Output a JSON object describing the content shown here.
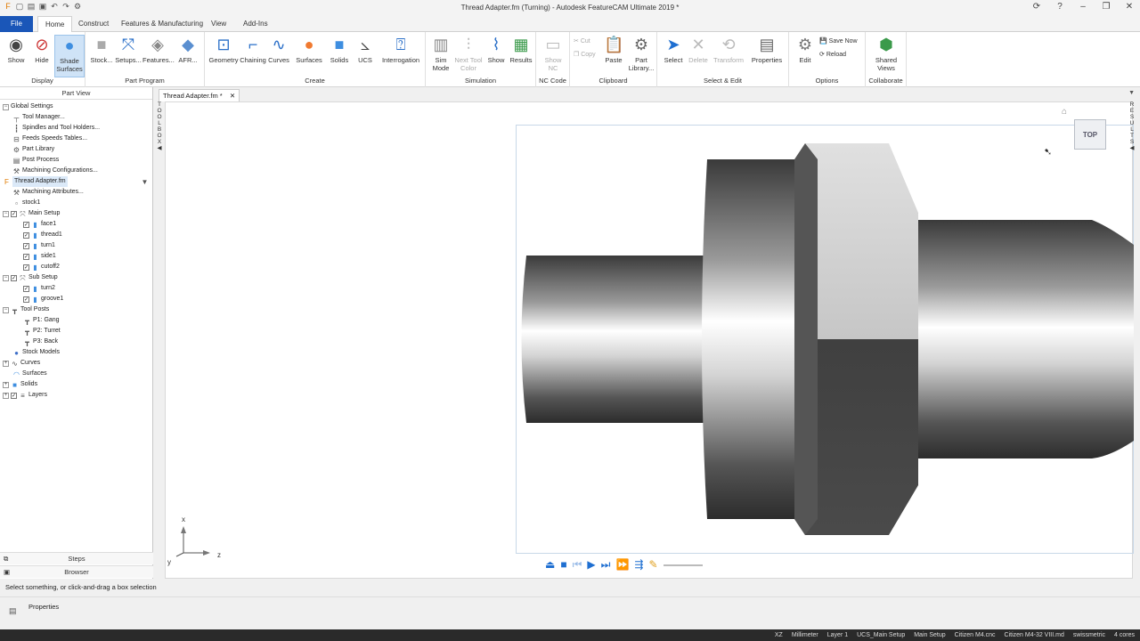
{
  "window": {
    "title": "Thread Adapter.fm (Turning) - Autodesk FeatureCAM Ultimate 2019 *"
  },
  "tabs": [
    "File",
    "Home",
    "Construct",
    "Features & Manufacturing",
    "View",
    "Add-Ins"
  ],
  "ribbon": {
    "display": {
      "label": "Display",
      "show": "Show",
      "hide": "Hide",
      "shade_surfaces": "Shade Surfaces"
    },
    "part_program": {
      "label": "Part Program",
      "stock": "Stock...",
      "setups": "Setups...",
      "features": "Features...",
      "afr": "AFR..."
    },
    "create": {
      "label": "Create",
      "geometry": "Geometry",
      "chaining": "Chaining",
      "curves": "Curves",
      "surfaces": "Surfaces",
      "solids": "Solids",
      "ucs": "UCS",
      "interrogation": "Interrogation"
    },
    "simulation": {
      "label": "Simulation",
      "sim_mode": "Sim Mode",
      "next_tool_color": "Next Tool Color",
      "show": "Show",
      "results": "Results"
    },
    "nc_code": {
      "label": "NC Code",
      "show_nc": "Show NC"
    },
    "clipboard": {
      "label": "Clipboard",
      "cut": "Cut",
      "copy": "Copy",
      "paste": "Paste",
      "part_library": "Part Library..."
    },
    "select_edit": {
      "label": "Select & Edit",
      "select": "Select",
      "delete": "Delete",
      "transform": "Transform",
      "properties": "Properties"
    },
    "options": {
      "label": "Options",
      "edit": "Edit",
      "save_now": "Save Now",
      "reload": "Reload"
    },
    "collaborate": {
      "label": "Collaborate",
      "shared_views": "Shared Views"
    }
  },
  "part_view": {
    "header": "Part View",
    "tree": [
      "Global Settings",
      "Tool Manager...",
      "Spindles and Tool Holders...",
      "Feeds  Speeds Tables...",
      "Part Library",
      "Post Process",
      "Machining Configurations...",
      "Thread Adapter.fm",
      "Machining Attributes...",
      "stock1",
      "Main Setup",
      "face1",
      "thread1",
      "turn1",
      "side1",
      "cutoff2",
      "Sub Setup",
      "turn2",
      "groove1",
      "Tool Posts",
      "P1: Gang",
      "P2: Turret",
      "P3: Back",
      "Stock Models",
      "Curves",
      "Surfaces",
      "Solids",
      "Layers"
    ],
    "footer_steps": "Steps",
    "footer_browser": "Browser"
  },
  "doc_tab": "Thread Adapter.fm *",
  "toolbox_label": "TOOLBOX",
  "results_label": "RESULTS",
  "view_cube": "TOP",
  "axes": {
    "x": "x",
    "y": "y",
    "z": "z"
  },
  "status_text": "Select something, or click-and-drag a box selection",
  "properties_label": "Properties",
  "statusbar": [
    "XZ",
    "Millimeter",
    "Layer 1",
    "UCS_Main Setup",
    "Main Setup",
    "Citizen M4.cnc",
    "Citizen M4-32 VIII.md",
    "swissmetric",
    "4 cores"
  ],
  "colors": {
    "file_tab": "#1a56b8",
    "accent": "#1f6fd1"
  }
}
